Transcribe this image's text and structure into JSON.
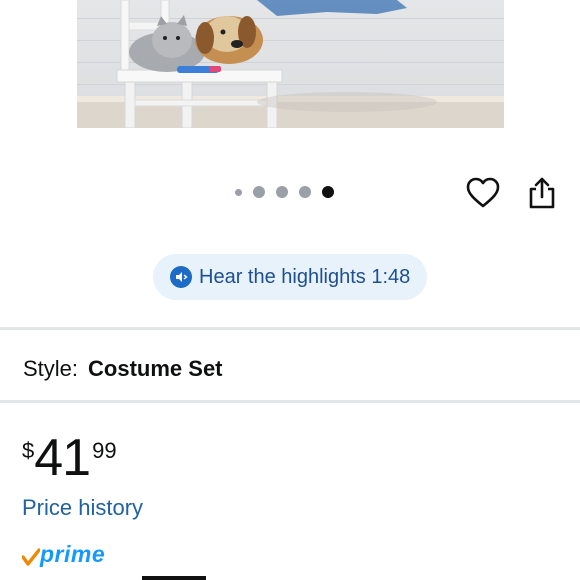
{
  "gallery": {
    "dot_count": 5,
    "active_index": 4
  },
  "actions": {
    "heart_icon": "heart-outline-icon",
    "share_icon": "share-icon"
  },
  "highlights": {
    "label": "Hear the highlights 1:48",
    "icon": "speaker-icon"
  },
  "style": {
    "label": "Style:",
    "value": "Costume Set"
  },
  "price": {
    "symbol": "$",
    "whole": "41",
    "fraction": "99"
  },
  "price_history": {
    "label": "Price history"
  },
  "prime": {
    "label": "prime",
    "check_color": "#f08804",
    "text_color": "#1399ff"
  },
  "colors": {
    "link": "#2162a1",
    "pill_bg": "#e8f2fb",
    "divider": "#e3e6e6"
  }
}
